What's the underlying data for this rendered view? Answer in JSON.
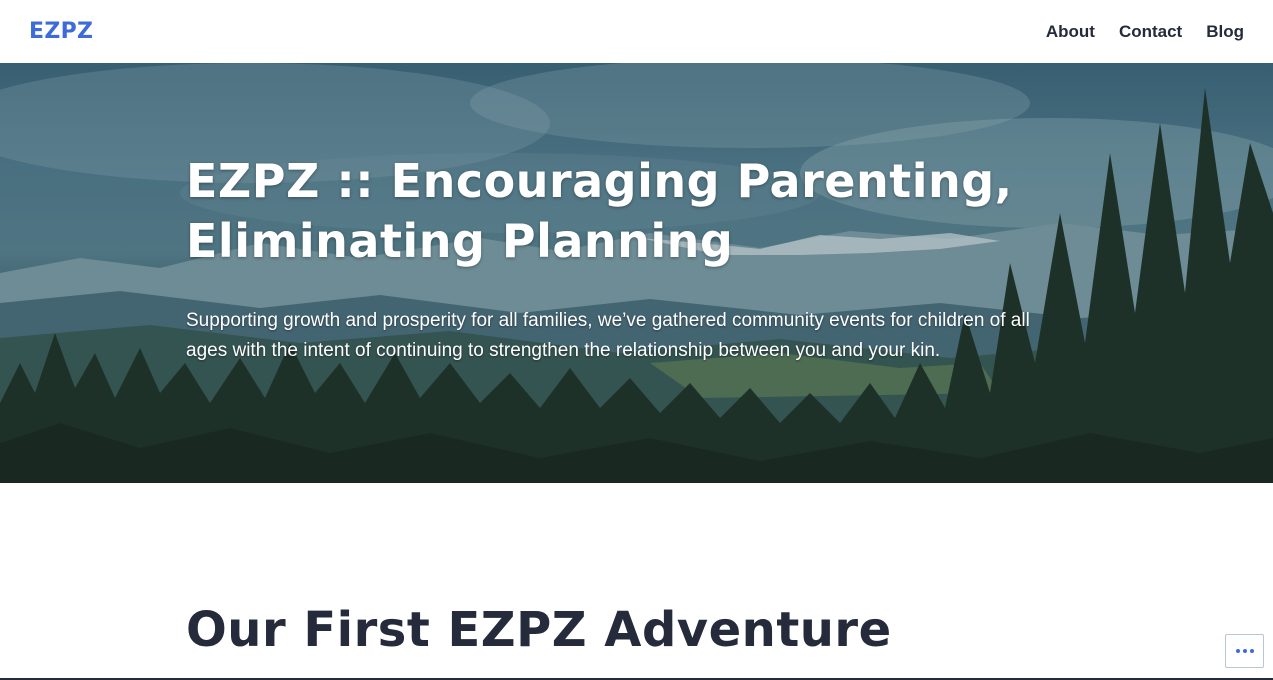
{
  "header": {
    "logo": "EZPZ",
    "nav": [
      {
        "label": "About"
      },
      {
        "label": "Contact"
      },
      {
        "label": "Blog"
      }
    ]
  },
  "hero": {
    "title_line1": "EZPZ :: Encouraging Parenting,",
    "title_line2": "Eliminating Planning",
    "description": "Supporting growth and prosperity for all families, we’ve gathered community events for children of all ages with the intent of continuing to strengthen the relationship between you and your kin.",
    "background": "mountain-forest-landscape-image"
  },
  "post": {
    "title": "Our First EZPZ Adventure"
  },
  "widgets": {
    "more_icon": "ellipsis-icon"
  },
  "colors": {
    "brand": "#3d6bd9",
    "text": "#252b3a",
    "background": "#ffffff"
  }
}
